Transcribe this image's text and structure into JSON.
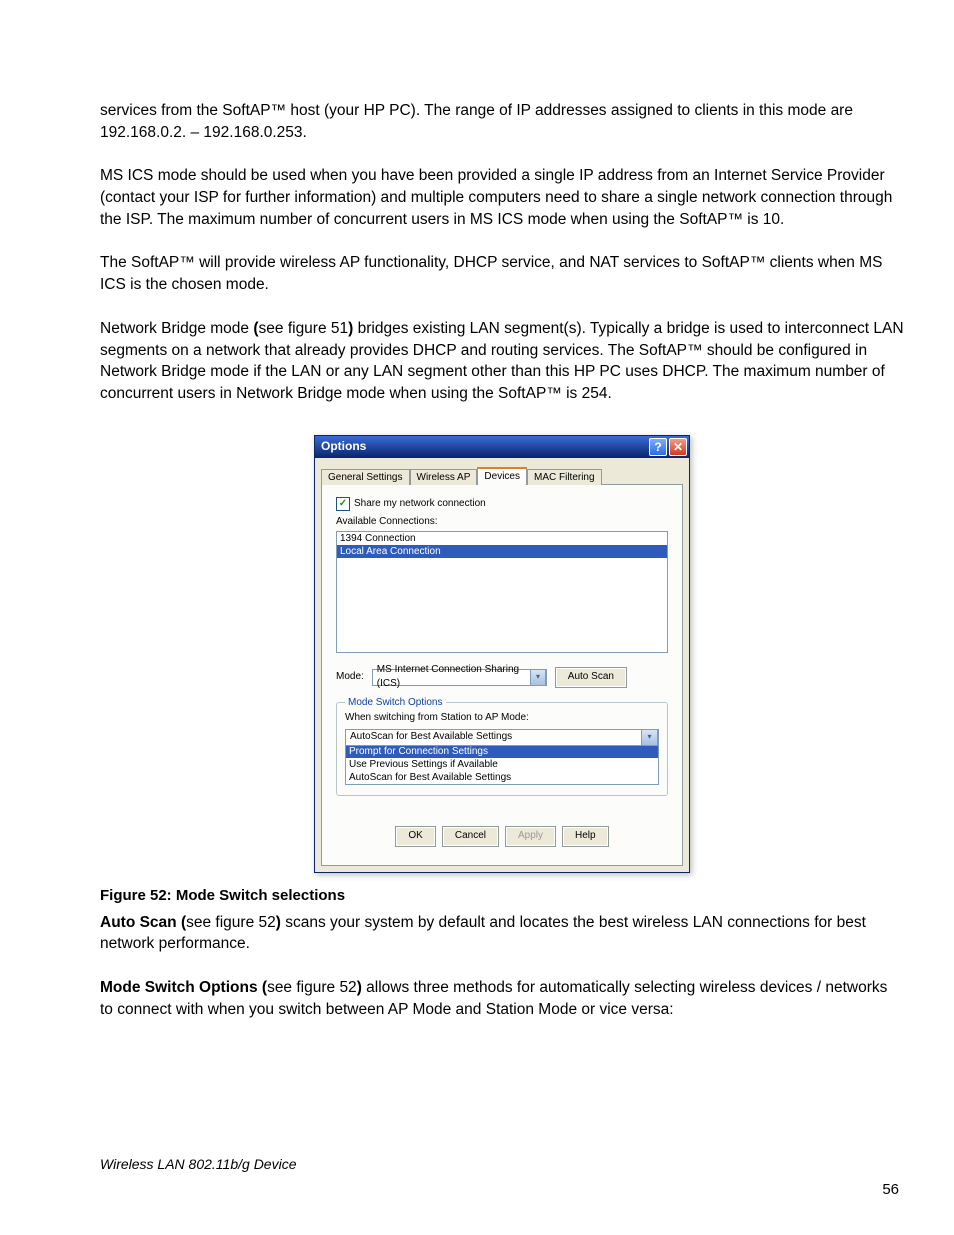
{
  "paragraphs": {
    "p1": "services from the SoftAP™ host (your HP PC). The range of IP addresses assigned to clients in this mode are 192.168.0.2. – 192.168.0.253.",
    "p2": "MS ICS mode should be used when you have been provided a single IP address from an Internet Service Provider (contact your ISP for further information) and multiple computers need to share a single network connection through the ISP.  The maximum number of concurrent users in MS ICS mode when using the SoftAP™ is 10.",
    "p3": "The SoftAP™ will provide wireless AP functionality, DHCP service, and NAT services to SoftAP™ clients when MS ICS is the chosen mode.",
    "p4_a": "Network Bridge mode ",
    "p4_b": "(",
    "p4_c": "see figure 51",
    "p4_d": ")",
    "p4_e": " bridges existing LAN segment(s).  Typically a bridge is used to interconnect LAN segments on a network that already provides DHCP and routing services.  The SoftAP™ should be configured in Network Bridge mode if the LAN or any LAN segment other than this HP PC uses DHCP. The maximum number of concurrent users in Network Bridge mode when using the SoftAP™ is 254."
  },
  "figure_caption": "Figure 52: Mode Switch selections",
  "p5_bold": "Auto Scan (",
  "p5_mid": "see figure 52",
  "p5_boldclose": ")",
  "p5_rest": " scans your system by default and locates the best wireless LAN connections for best network performance.",
  "p6_bold": "Mode Switch Options (",
  "p6_mid": "see figure 52",
  "p6_boldclose": ")",
  "p6_rest": " allows three methods for automatically selecting wireless devices / networks to connect with when you switch between AP Mode and Station Mode or vice versa:",
  "footer_left": "Wireless LAN 802.11b/g Device",
  "footer_right": "56",
  "dialog": {
    "title": "Options",
    "help_glyph": "?",
    "close_glyph": "✕",
    "tabs": [
      "General Settings",
      "Wireless AP",
      "Devices",
      "MAC Filtering"
    ],
    "active_tab": 2,
    "share_label": "Share my network connection",
    "avail_label": "Available Connections:",
    "connections": [
      "1394 Connection",
      "Local Area Connection"
    ],
    "selected_connection": 1,
    "mode_label": "Mode:",
    "mode_value": "MS Internet Connection Sharing (ICS)",
    "autoscan_btn": "Auto Scan",
    "fieldset_legend": "Mode Switch Options",
    "switch_label": "When switching from Station to AP Mode:",
    "combo_value": "AutoScan for Best Available Settings",
    "combo_options": [
      "Prompt for Connection Settings",
      "Use Previous Settings if Available",
      "AutoScan for Best Available Settings"
    ],
    "combo_selected": 0,
    "buttons": {
      "ok": "OK",
      "cancel": "Cancel",
      "apply": "Apply",
      "help": "Help"
    },
    "arrow_glyph": "▾",
    "check_glyph": "✓"
  }
}
